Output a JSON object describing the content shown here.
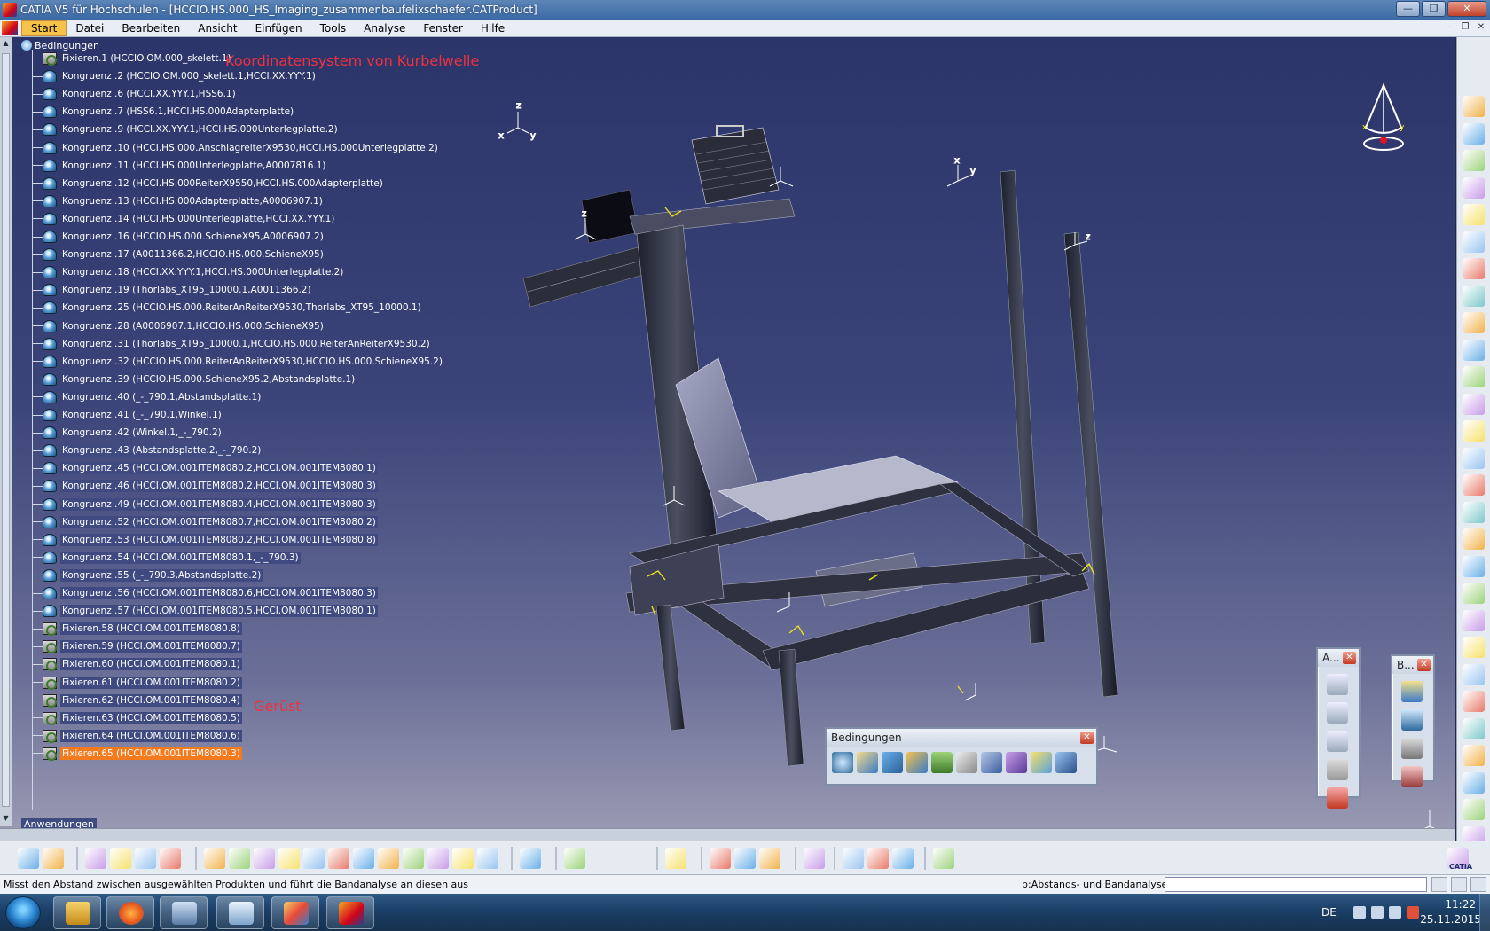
{
  "window": {
    "title": "CATIA V5 für Hochschulen - [HCCIO.HS.000_HS_Imaging_zusammenbaufelixschaefer.CATProduct]",
    "btn_min": "—",
    "btn_max": "❐",
    "btn_close": "✕"
  },
  "menubar": {
    "items": [
      "Start",
      "Datei",
      "Bearbeiten",
      "Ansicht",
      "Einfügen",
      "Tools",
      "Analyse",
      "Fenster",
      "Hilfe"
    ],
    "ctrl_min": "–",
    "ctrl_restore": "❐",
    "ctrl_close": "✕"
  },
  "tree": {
    "root_label": "Bedingungen",
    "rows": [
      {
        "label": "Fixieren.1 (HCCIO.OM.000_skelett.1)",
        "icon": "fix-icon"
      },
      {
        "label": "Kongruenz .2 (HCCIO.OM.000_skelett.1,HCCI.XX.YYY.1)",
        "icon": "kongruenz-icon"
      },
      {
        "label": "Kongruenz .6 (HCCI.XX.YYY.1,HSS6.1)",
        "icon": "kongruenz-icon"
      },
      {
        "label": "Kongruenz .7 (HSS6.1,HCCI.HS.000Adapterplatte)",
        "icon": "kongruenz-icon"
      },
      {
        "label": "Kongruenz .9 (HCCI.XX.YYY.1,HCCI.HS.000Unterlegplatte.2)",
        "icon": "kongruenz-icon"
      },
      {
        "label": "Kongruenz .10 (HCCI.HS.000.AnschlagreiterX9530,HCCI.HS.000Unterlegplatte.2)",
        "icon": "kongruenz-icon"
      },
      {
        "label": "Kongruenz .11 (HCCI.HS.000Unterlegplatte,A0007816.1)",
        "icon": "kongruenz-icon"
      },
      {
        "label": "Kongruenz .12 (HCCI.HS.000ReiterX9550,HCCI.HS.000Adapterplatte)",
        "icon": "kongruenz-icon"
      },
      {
        "label": "Kongruenz .13 (HCCI.HS.000Adapterplatte,A0006907.1)",
        "icon": "kongruenz-icon"
      },
      {
        "label": "Kongruenz .14 (HCCI.HS.000Unterlegplatte,HCCI.XX.YYY.1)",
        "icon": "kongruenz-icon"
      },
      {
        "label": "Kongruenz .16 (HCCIO.HS.000.SchieneX95,A0006907.2)",
        "icon": "kongruenz-icon"
      },
      {
        "label": "Kongruenz .17 (A0011366.2,HCCIO.HS.000.SchieneX95)",
        "icon": "kongruenz-icon"
      },
      {
        "label": "Kongruenz .18 (HCCI.XX.YYY.1,HCCI.HS.000Unterlegplatte.2)",
        "icon": "kongruenz-icon"
      },
      {
        "label": "Kongruenz .19 (Thorlabs_XT95_10000.1,A0011366.2)",
        "icon": "kongruenz-icon"
      },
      {
        "label": "Kongruenz .25 (HCCIO.HS.000.ReiterAnReiterX9530,Thorlabs_XT95_10000.1)",
        "icon": "kongruenz-icon"
      },
      {
        "label": "Kongruenz .28 (A0006907.1,HCCIO.HS.000.SchieneX95)",
        "icon": "kongruenz-icon"
      },
      {
        "label": "Kongruenz .31 (Thorlabs_XT95_10000.1,HCCIO.HS.000.ReiterAnReiterX9530.2)",
        "icon": "kongruenz-icon"
      },
      {
        "label": "Kongruenz .32 (HCCIO.HS.000.ReiterAnReiterX9530,HCCIO.HS.000.SchieneX95.2)",
        "icon": "kongruenz-icon"
      },
      {
        "label": "Kongruenz .39 (HCCIO.HS.000.SchieneX95.2,Abstandsplatte.1)",
        "icon": "kongruenz-icon"
      },
      {
        "label": "Kongruenz .40 (_-_790.1,Abstandsplatte.1)",
        "icon": "kongruenz-icon"
      },
      {
        "label": "Kongruenz .41 (_-_790.1,Winkel.1)",
        "icon": "kongruenz-icon"
      },
      {
        "label": "Kongruenz .42 (Winkel.1,_-_790.2)",
        "icon": "kongruenz-icon"
      },
      {
        "label": "Kongruenz .43 (Abstandsplatte.2,_-_790.2)",
        "icon": "kongruenz-icon",
        "hl": true
      },
      {
        "label": "Kongruenz .45 (HCCI.OM.001ITEM8080.2,HCCI.OM.001ITEM8080.1)",
        "icon": "kongruenz-icon",
        "hl": true
      },
      {
        "label": "Kongruenz .46 (HCCI.OM.001ITEM8080.2,HCCI.OM.001ITEM8080.3)",
        "icon": "kongruenz-icon",
        "hl": true
      },
      {
        "label": "Kongruenz .49 (HCCI.OM.001ITEM8080.4,HCCI.OM.001ITEM8080.3)",
        "icon": "kongruenz-icon",
        "hl": true
      },
      {
        "label": "Kongruenz .52 (HCCI.OM.001ITEM8080.7,HCCI.OM.001ITEM8080.2)",
        "icon": "kongruenz-icon",
        "hl": true
      },
      {
        "label": "Kongruenz .53 (HCCI.OM.001ITEM8080.2,HCCI.OM.001ITEM8080.8)",
        "icon": "kongruenz-icon",
        "hl": true
      },
      {
        "label": "Kongruenz .54 (HCCI.OM.001ITEM8080.1,_-_790.3)",
        "icon": "kongruenz-icon",
        "hl": true
      },
      {
        "label": "Kongruenz .55 (_-_790.3,Abstandsplatte.2)",
        "icon": "kongruenz-icon",
        "hl": true
      },
      {
        "label": "Kongruenz .56 (HCCI.OM.001ITEM8080.6,HCCI.OM.001ITEM8080.3)",
        "icon": "kongruenz-icon",
        "hl": true
      },
      {
        "label": "Kongruenz .57 (HCCI.OM.001ITEM8080.5,HCCI.OM.001ITEM8080.1)",
        "icon": "kongruenz-icon",
        "hl": true
      },
      {
        "label": "Fixieren.58 (HCCI.OM.001ITEM8080.8)",
        "icon": "fix-icon",
        "hl": true
      },
      {
        "label": "Fixieren.59 (HCCI.OM.001ITEM8080.7)",
        "icon": "fix-icon",
        "hl": true
      },
      {
        "label": "Fixieren.60 (HCCI.OM.001ITEM8080.1)",
        "icon": "fix-icon",
        "hl": true
      },
      {
        "label": "Fixieren.61 (HCCI.OM.001ITEM8080.2)",
        "icon": "fix-icon",
        "hl": true
      },
      {
        "label": "Fixieren.62 (HCCI.OM.001ITEM8080.4)",
        "icon": "fix-icon",
        "hl": true
      },
      {
        "label": "Fixieren.63 (HCCI.OM.001ITEM8080.5)",
        "icon": "fix-icon",
        "hl": true
      },
      {
        "label": "Fixieren.64 (HCCI.OM.001ITEM8080.6)",
        "icon": "fix-icon",
        "hl": true
      },
      {
        "label": "Fixieren.65 (HCCI.OM.001ITEM8080.3)",
        "icon": "fix-icon",
        "sel": true
      }
    ],
    "applications_label": "Anwendungen"
  },
  "annotations": {
    "koordinaten": "Koordinatensystem von Kurbelwelle",
    "geruest": "Gerüst"
  },
  "toolbars": {
    "bedingungen_title": "Bedingungen",
    "a_title": "A...",
    "b_title": "B...",
    "close": "✕"
  },
  "statusbar": {
    "message": "Misst den Abstand zwischen ausgewählten Produkten und führt die Bandanalyse an diesen aus",
    "command": "b:Abstands- und Bandanalyse",
    "input_value": ""
  },
  "taskbar": {
    "lang": "DE",
    "time": "11:22",
    "date": "25.11.2015"
  },
  "brand": {
    "catia_label": "CATIA"
  },
  "colors": {
    "annotation_red": "#f0313e",
    "selection_orange": "#f47a1e",
    "highlight_blue": "#3e4a80"
  }
}
